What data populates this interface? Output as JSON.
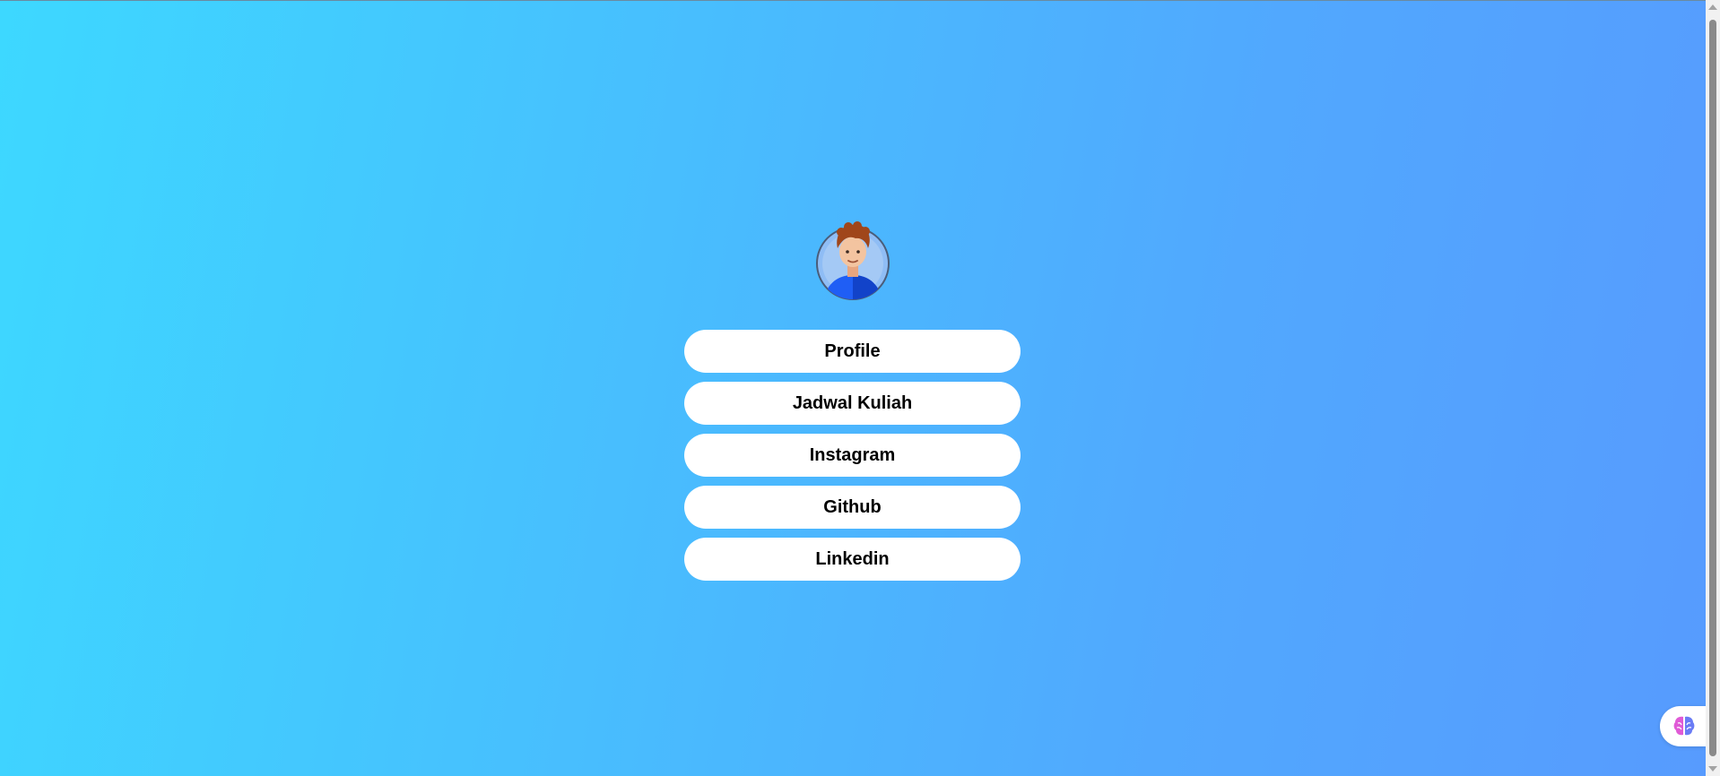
{
  "avatar": {
    "icon": "boy-avatar-icon"
  },
  "links": [
    {
      "label": "Profile"
    },
    {
      "label": "Jadwal Kuliah"
    },
    {
      "label": "Instagram"
    },
    {
      "label": "Github"
    },
    {
      "label": "Linkedin"
    }
  ],
  "widget": {
    "icon": "brain-icon"
  },
  "colors": {
    "gradient_start": "#3dd8ff",
    "gradient_end": "#579bfe",
    "button_bg": "#ffffff",
    "button_text": "#000000"
  }
}
